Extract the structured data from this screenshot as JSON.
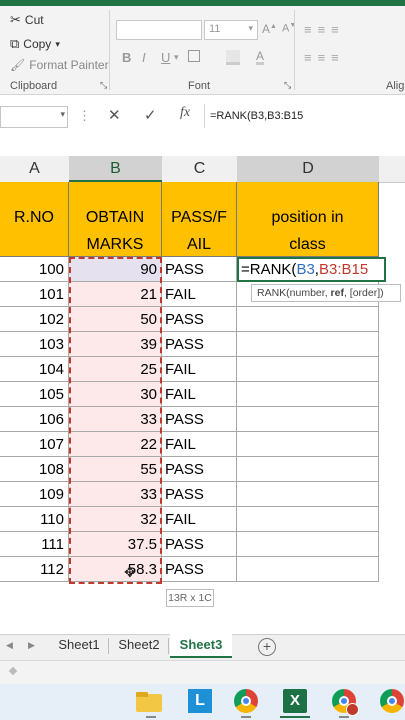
{
  "ribbon": {
    "cut_label": "Cut",
    "copy_label": "Copy",
    "format_painter_label": "Format Painter",
    "clipboard_label": "Clipboard",
    "font_label": "Font",
    "font_size": "11",
    "bold": "B",
    "italic": "I",
    "underline": "U",
    "alignment_label": "Alig"
  },
  "formula_bar": {
    "cancel_glyph": "✕",
    "enter_glyph": "✓",
    "fx_glyph": "fx",
    "formula": "=RANK(B3,B3:B15"
  },
  "columns": [
    "A",
    "B",
    "C",
    "D"
  ],
  "header_row": {
    "a": "R.NO",
    "b_line1": "OBTAIN",
    "b_line2": "MARKS",
    "c_line1": "PASS/F",
    "c_line2": "AIL",
    "d_line1": "position in",
    "d_line2": "class"
  },
  "rows": [
    {
      "rno": "100",
      "marks": "90",
      "status": "PASS"
    },
    {
      "rno": "101",
      "marks": "21",
      "status": "FAIL"
    },
    {
      "rno": "102",
      "marks": "50",
      "status": "PASS"
    },
    {
      "rno": "103",
      "marks": "39",
      "status": "PASS"
    },
    {
      "rno": "104",
      "marks": "25",
      "status": "FAIL"
    },
    {
      "rno": "105",
      "marks": "30",
      "status": "FAIL"
    },
    {
      "rno": "106",
      "marks": "33",
      "status": "PASS"
    },
    {
      "rno": "107",
      "marks": "22",
      "status": "FAIL"
    },
    {
      "rno": "108",
      "marks": "55",
      "status": "PASS"
    },
    {
      "rno": "109",
      "marks": "33",
      "status": "PASS"
    },
    {
      "rno": "110",
      "marks": "32",
      "status": "FAIL"
    },
    {
      "rno": "111",
      "marks": "37.5",
      "status": "PASS"
    },
    {
      "rno": "112",
      "marks": "58.3",
      "status": "PASS"
    }
  ],
  "editing": {
    "prefix": "=RANK(",
    "ref1": "B3",
    "comma": ",",
    "ref2": "B3:B15",
    "tooltip_pre": "RANK(number, ",
    "tooltip_bold": "ref",
    "tooltip_post": ", [order])"
  },
  "selection_size": "13R x 1C",
  "sheets": [
    "Sheet1",
    "Sheet2",
    "Sheet3"
  ],
  "active_sheet": "Sheet3",
  "taskbar": {
    "launcher_letter": "L",
    "excel_letter": "X"
  },
  "colors": {
    "header_fill": "#ffc000",
    "excel_green": "#217346",
    "selection_fill": "#fde9e9",
    "ref1_blue": "#2f6fbf",
    "ref2_red": "#c0392b"
  }
}
